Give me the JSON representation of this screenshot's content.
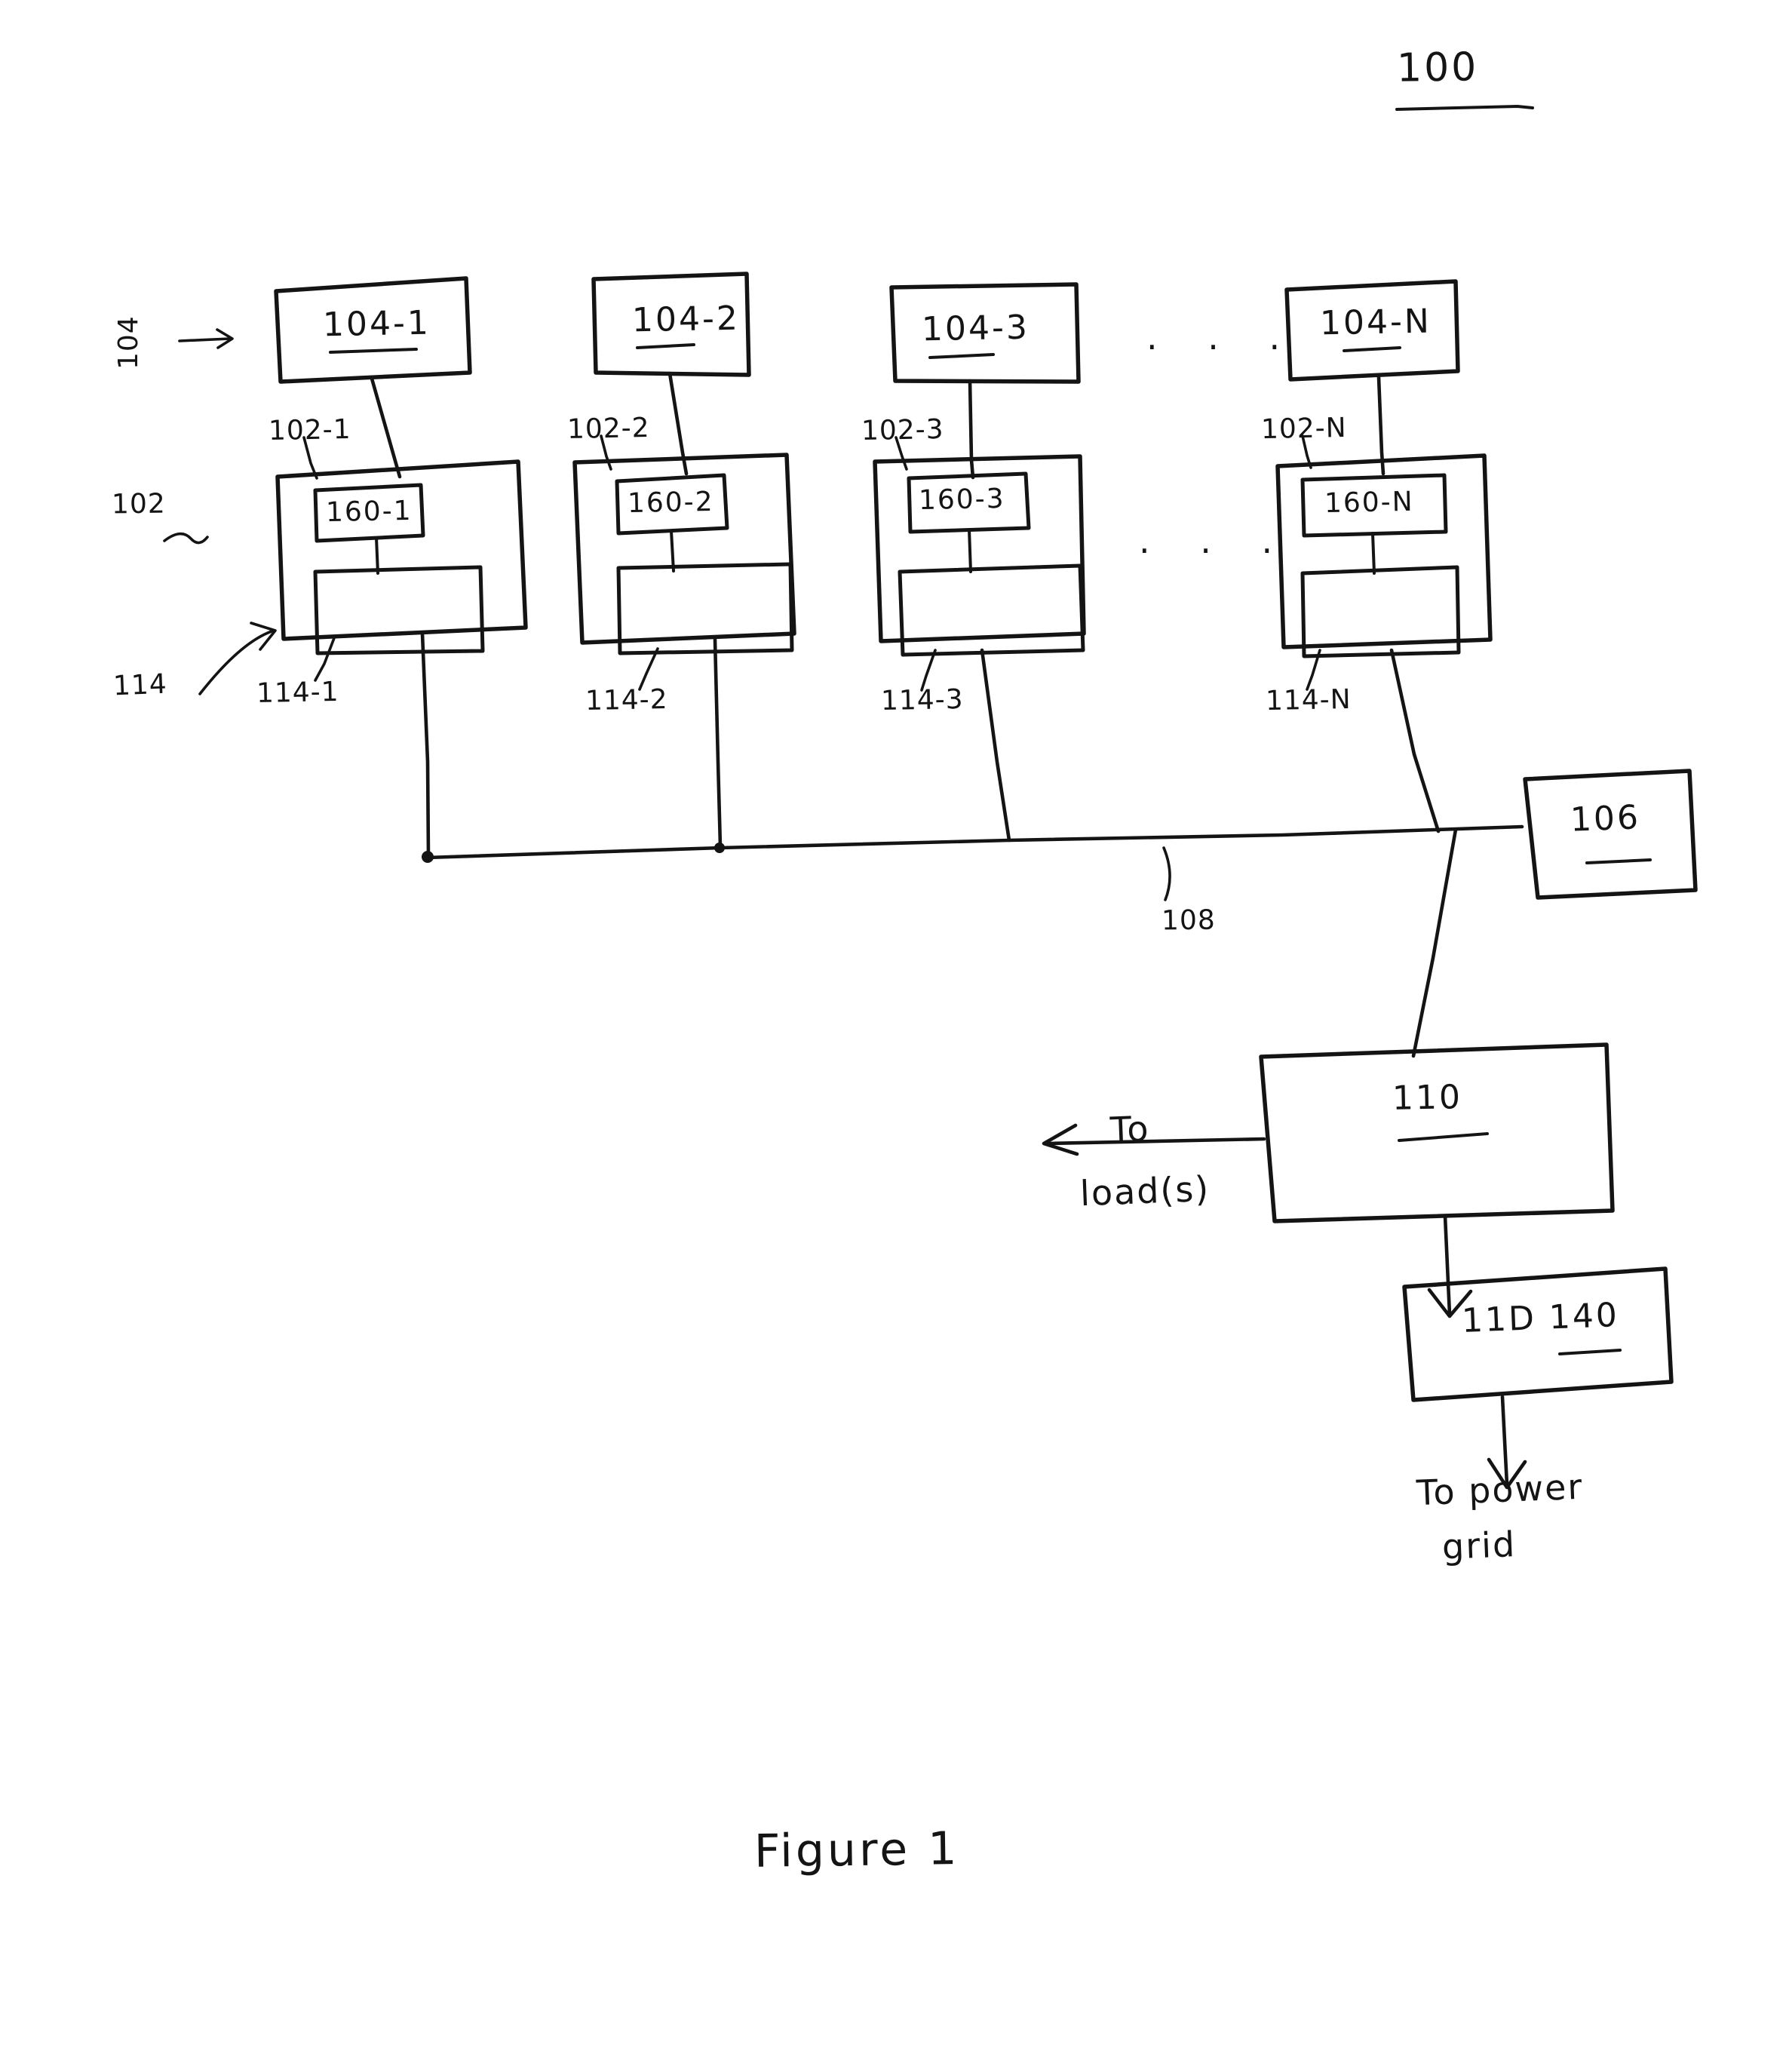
{
  "figure": {
    "caption": "Figure 1",
    "system_number": "100"
  },
  "group_labels": {
    "modules_group": "104",
    "units_group": "102",
    "subunits_group": "114"
  },
  "top_row": {
    "boxes": [
      {
        "label": "104-1"
      },
      {
        "label": "104-2"
      },
      {
        "label": "104-3"
      },
      {
        "label": "104-N"
      }
    ],
    "ellipsis": ". . ."
  },
  "unit_row": {
    "boxes": [
      {
        "ref": "102-1",
        "inner_label": "160-1",
        "sub_ref": "114-1"
      },
      {
        "ref": "102-2",
        "inner_label": "160-2",
        "sub_ref": "114-2"
      },
      {
        "ref": "102-3",
        "inner_label": "160-3",
        "sub_ref": "114-3"
      },
      {
        "ref": "102-N",
        "inner_label": "160-N",
        "sub_ref": "114-N"
      }
    ],
    "ellipsis": ". . ."
  },
  "bus": {
    "label": "108"
  },
  "controller": {
    "label": "106"
  },
  "converter": {
    "label": "110",
    "output_note": "To\nload(s)",
    "output_note_line1": "To",
    "output_note_line2": "load(s)"
  },
  "grid_interface": {
    "label": "11D 140",
    "output_note_line1": "To power",
    "output_note_line2": "grid"
  },
  "colors": {
    "ink": "#141414",
    "paper": "#ffffff"
  }
}
